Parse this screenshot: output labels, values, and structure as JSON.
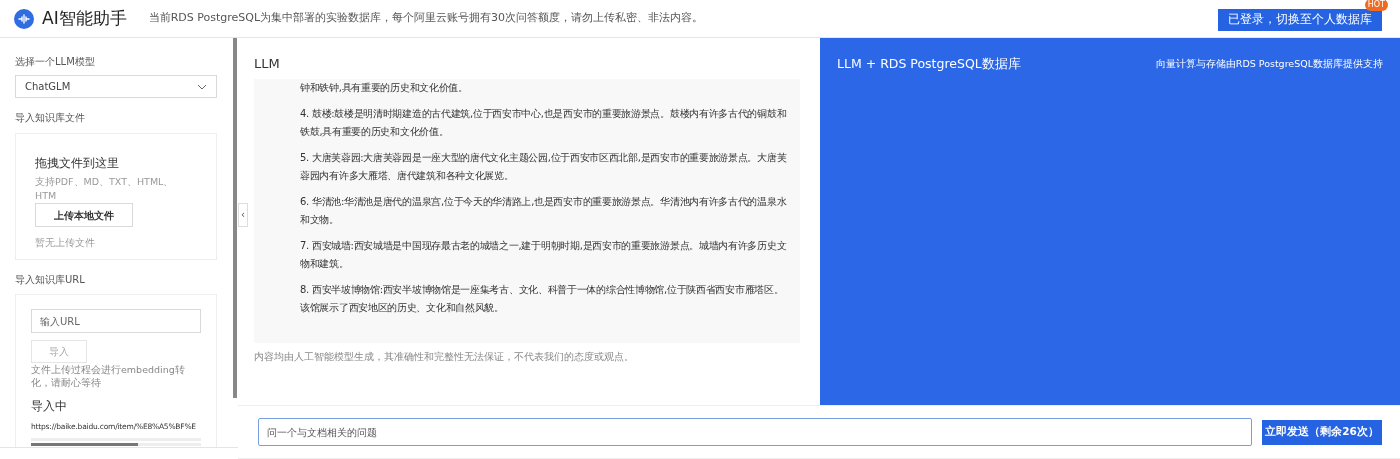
{
  "header": {
    "title": "AI智能助手",
    "notice": "当前RDS PostgreSQL为集中部署的实验数据库，每个阿里云账号拥有30次问答额度，请勿上传私密、非法内容。",
    "login_button": "已登录，切换至个人数据库",
    "badge": "HOT"
  },
  "sidebar": {
    "model_label": "选择一个LLM模型",
    "model_value": "ChatGLM",
    "file_label": "导入知识库文件",
    "drop_title": "拖拽文件到这里",
    "drop_hint": "支持PDF、MD、TXT、HTML、HTM",
    "upload_button": "上传本地文件",
    "no_files": "暂无上传文件",
    "url_label": "导入知识库URL",
    "url_placeholder": "输入URL",
    "import_button": "导入",
    "import_note": "文件上传过程会进行embedding转化，请耐心等待",
    "importing_title": "导入中",
    "importing_url": "https://baike.baidu.com/item/%E8%A5%BF%E",
    "progress": {
      "level": 0.63
    }
  },
  "llm_panel": {
    "title": "LLM",
    "collapse": "‹",
    "paragraphs": [
      "钟和铁钟,具有重要的历史和文化价值。",
      "4. 鼓楼:鼓楼是明清时期建造的古代建筑,位于西安市中心,也是西安市的重要旅游景点。鼓楼内有许多古代的铜鼓和铁鼓,具有重要的历史和文化价值。",
      "5. 大唐芙蓉园:大唐芙蓉园是一座大型的唐代文化主题公园,位于西安市区西北部,是西安市的重要旅游景点。大唐芙蓉园内有许多大雁塔、唐代建筑和各种文化展览。",
      "6. 华清池:华清池是唐代的温泉宫,位于今天的华清路上,也是西安市的重要旅游景点。华清池内有许多古代的温泉水和文物。",
      "7. 西安城墙:西安城墙是中国现存最古老的城墙之一,建于明朝时期,是西安市的重要旅游景点。城墙内有许多历史文物和建筑。",
      "8. 西安半坡博物馆:西安半坡博物馆是一座集考古、文化、科普于一体的综合性博物馆,位于陕西省西安市雁塔区。该馆展示了西安地区的历史、文化和自然风貌。"
    ],
    "disclaimer": "内容均由人工智能模型生成，其准确性和完整性无法保证，不代表我们的态度或观点。"
  },
  "db_panel": {
    "title": "LLM + RDS PostgreSQL数据库",
    "subtitle": "向量计算与存储由RDS PostgreSQL数据库提供支持"
  },
  "composer": {
    "placeholder": "问一个与文档相关的问题",
    "send_button": "立即发送（剩余26次）"
  }
}
